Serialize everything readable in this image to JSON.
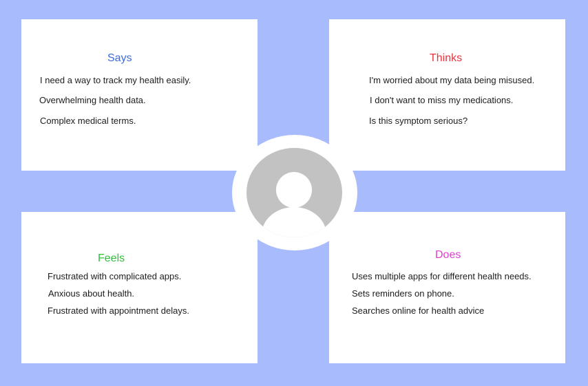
{
  "says": {
    "title": "Says",
    "title_color": "#3d6bd9",
    "items": [
      "I need a way to track my health easily.",
      "Overwhelming health data.",
      "Complex medical terms."
    ]
  },
  "thinks": {
    "title": "Thinks",
    "title_color": "#e8343f",
    "items": [
      "I'm worried about my data being misused.",
      "I don't want to miss my medications.",
      "Is this symptom serious?"
    ]
  },
  "feels": {
    "title": "Feels",
    "title_color": "#2fbf3b",
    "items": [
      "Frustrated with complicated apps.",
      "Anxious about health.",
      "Frustrated with appointment delays."
    ]
  },
  "does": {
    "title": "Does",
    "title_color": "#e03fd0",
    "items": [
      "Uses multiple apps for different health needs.",
      "Sets reminders on phone.",
      "Searches online for health advice"
    ]
  },
  "avatar": {
    "icon": "user-avatar-icon",
    "background_color": "#c2c2c2"
  },
  "background_color": "#a8bcfd"
}
